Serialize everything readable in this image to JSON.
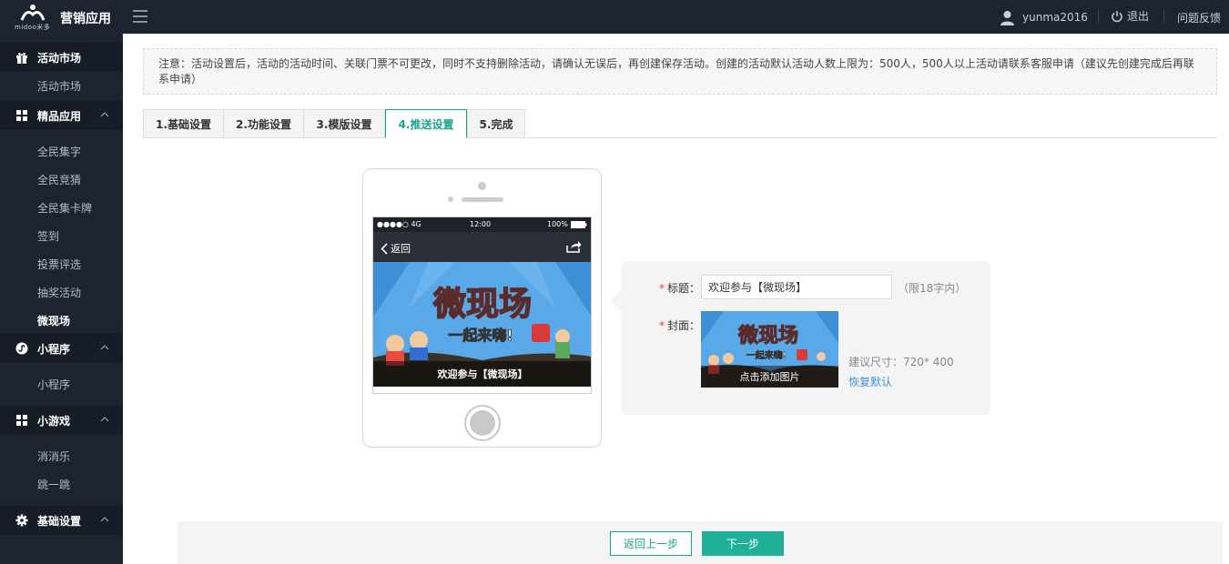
{
  "header": {
    "logo_text": "midoo米多",
    "app_title": "营销应用",
    "username": "yunma2016",
    "logout_label": "退出",
    "feedback_label": "问题反馈"
  },
  "sidebar": {
    "sections": [
      {
        "label": "活动市场",
        "icon": "gift-icon",
        "items": [
          "活动市场"
        ]
      },
      {
        "label": "精品应用",
        "icon": "grid-icon",
        "items": [
          "全民集字",
          "全民竞猜",
          "全民集卡牌",
          "签到",
          "投票评选",
          "抽奖活动",
          "微现场"
        ],
        "active": "微现场"
      },
      {
        "label": "小程序",
        "icon": "miniprogram-icon",
        "items": [
          "小程序"
        ]
      },
      {
        "label": "小游戏",
        "icon": "grid-icon",
        "items": [
          "消消乐",
          "跳一跳"
        ]
      },
      {
        "label": "基础设置",
        "icon": "gear-icon",
        "items": []
      }
    ]
  },
  "notice": "注意：活动设置后，活动的活动时间、关联门票不可更改，同时不支持删除活动，请确认无误后，再创建保存活动。创建的活动默认活动人数上限为：500人，500人以上活动请联系客服申请（建议先创建完成后再联系申请）",
  "tabs": [
    {
      "label": "1.基础设置"
    },
    {
      "label": "2.功能设置"
    },
    {
      "label": "3.模版设置"
    },
    {
      "label": "4.推送设置",
      "active": true
    },
    {
      "label": "5.完成"
    }
  ],
  "phone": {
    "carrier": "●●●●○ 4G",
    "time": "12:00",
    "battery": "100%",
    "back_label": "返回",
    "banner_title": "微现场",
    "banner_subtitle": "一起来嗨!",
    "caption": "欢迎参与【微现场】"
  },
  "form": {
    "title_label": "标题：",
    "title_value": "欢迎参与【微现场】",
    "title_hint": "（限18字内）",
    "cover_label": "封面：",
    "cover_caption": "点击添加图片",
    "size_hint": "建议尺寸：720* 400",
    "restore_label": "恢复默认"
  },
  "footer": {
    "prev_label": "返回上一步",
    "next_label": "下一步"
  },
  "colors": {
    "accent": "#1aa38c",
    "sidebar_bg": "#1d2430",
    "link": "#3a90d8"
  }
}
